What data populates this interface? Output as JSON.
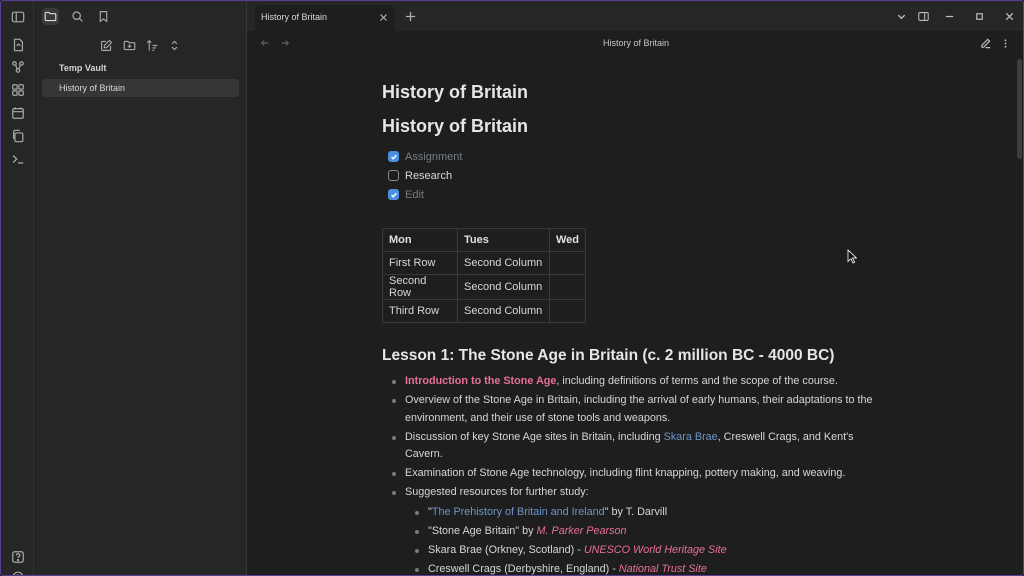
{
  "tab": {
    "title": "History of Britain"
  },
  "header": {
    "title": "History of Britain"
  },
  "sidebar": {
    "vault_name": "Temp Vault",
    "files": [
      {
        "name": "History of Britain"
      }
    ]
  },
  "note": {
    "heading1": "History of Britain",
    "heading2": "History of Britain",
    "tasks": [
      {
        "label": "Assignment",
        "checked": true
      },
      {
        "label": "Research",
        "checked": false
      },
      {
        "label": "Edit",
        "checked": true
      }
    ],
    "table": {
      "headers": [
        "Mon",
        "Tues",
        "Wed"
      ],
      "rows": [
        [
          "First Row",
          "Second Column",
          ""
        ],
        [
          "Second Row",
          "Second Column",
          ""
        ],
        [
          "Third Row",
          "Second Column",
          ""
        ]
      ]
    },
    "lesson_heading": "Lesson 1: The Stone Age in Britain (c. 2 million BC - 4000 BC)",
    "bullets": {
      "b1_highlight": "Introduction to the Stone Age",
      "b1_rest": ", including definitions of terms and the scope of the course.",
      "b2": "Overview of the Stone Age in Britain, including the arrival of early humans, their adaptations to the environment, and their use of stone tools and weapons.",
      "b3_pre": "Discussion of key Stone Age sites in Britain, including ",
      "b3_link": "Skara Brae",
      "b3_post": ", Creswell Crags, and Kent's Cavern.",
      "b4": "Examination of Stone Age technology, including flint knapping, pottery making, and weaving.",
      "b5": "Suggested resources for further study:",
      "sub": {
        "s1_q1": "\"",
        "s1_link": "The Prehistory of Britain and Ireland",
        "s1_post": "\" by T. Darvill",
        "s2_pre": "\"Stone Age Britain\" by ",
        "s2_ital": "M. Parker Pearson",
        "s3_pre": "Skara Brae (Orkney, Scotland) - ",
        "s3_ital": "UNESCO World Heritage Site",
        "s4_pre": "Creswell Crags (Derbyshire, England) - ",
        "s4_ital": "National Trust Site"
      }
    }
  },
  "colors": {
    "accent": "#5b3e94",
    "checkbox": "#4a8fe0",
    "highlight_pink": "#e86f9b",
    "link_blue": "#6f94c8"
  },
  "icons": {
    "ribbon": [
      "sidebar-toggle-icon",
      "open-quick-switcher-icon",
      "graph-view-icon",
      "canvas-icon",
      "daily-note-icon",
      "templates-icon",
      "command-palette-icon",
      "help-icon",
      "settings-icon"
    ],
    "sidebar_tabs": [
      "files-icon",
      "search-icon",
      "bookmark-icon"
    ],
    "sidebar_actions": [
      "new-note-icon",
      "new-folder-icon",
      "sort-icon",
      "collapse-icon"
    ]
  }
}
